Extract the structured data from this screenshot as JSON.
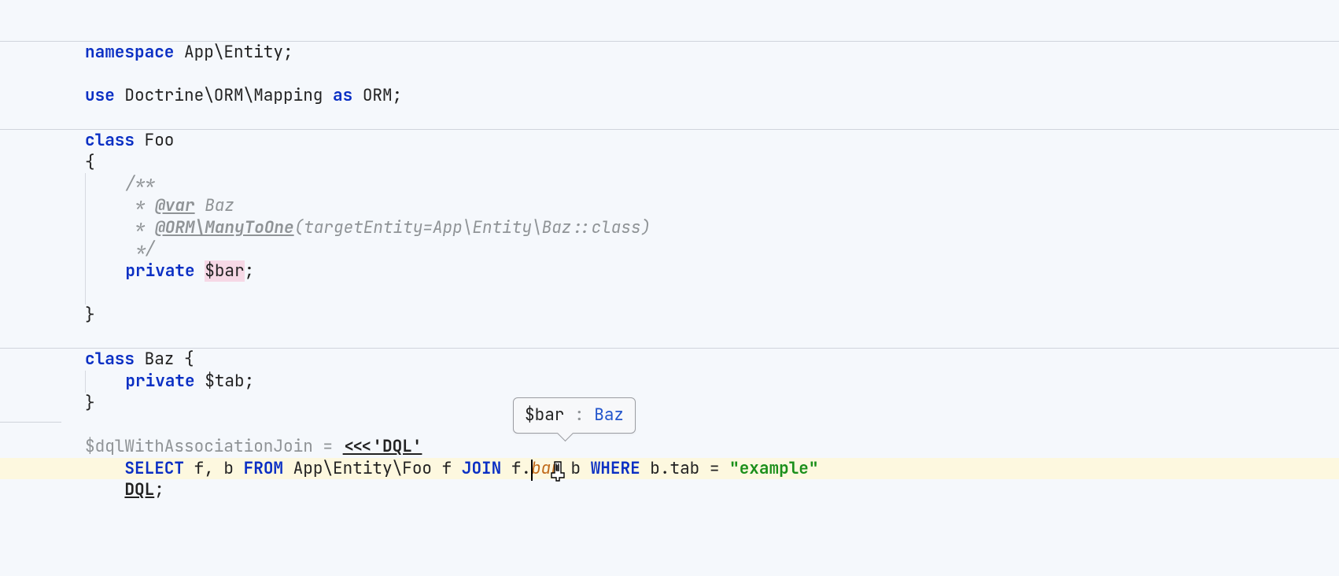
{
  "code": {
    "l1_namespace_kw": "namespace",
    "l1_namespace_name": " App\\Entity;",
    "l2_use_kw": "use",
    "l2_use_path": " Doctrine\\ORM\\Mapping ",
    "l2_as_kw": "as",
    "l2_use_alias": " ORM;",
    "l3_class_kw": "class",
    "l3_class_name": " Foo",
    "l3_open_brace": "{",
    "doc_open": "    /**",
    "doc_var_prefix": "     * ",
    "doc_var_tag": "@var",
    "doc_var_type": " Baz",
    "doc_orm_prefix": "     * ",
    "doc_orm_tag": "@ORM\\ManyToOne",
    "doc_orm_args": "(targetEntity=App\\Entity\\Baz::class)",
    "doc_close": "     */",
    "priv_kw": "private",
    "priv_sp": " ",
    "priv_var": "$bar",
    "priv_semi": ";",
    "close_brace": "}",
    "baz_class_kw": "class",
    "baz_class_decl": " Baz {",
    "baz_priv_kw": "private",
    "baz_priv_rest": " $tab;",
    "baz_close": "}",
    "dql_var": "$dqlWithAssociationJoin",
    "dql_assign": " = ",
    "dql_open": "<<<'DQL'",
    "sql_indent": "    ",
    "sql_select": "SELECT",
    "sql_cols": " f, b ",
    "sql_from": "FROM",
    "sql_table": " App\\Entity\\Foo f ",
    "sql_join": "JOIN",
    "sql_join_pre": " f.",
    "sql_join_field": "bar",
    "sql_join_alias": " b ",
    "sql_where": "WHERE",
    "sql_cond": " b.tab = ",
    "sql_str": "\"example\"",
    "dql_end": "DQL",
    "dql_semi": ";"
  },
  "tooltip": {
    "var": "$bar",
    "sep": " : ",
    "type": "Baz"
  }
}
